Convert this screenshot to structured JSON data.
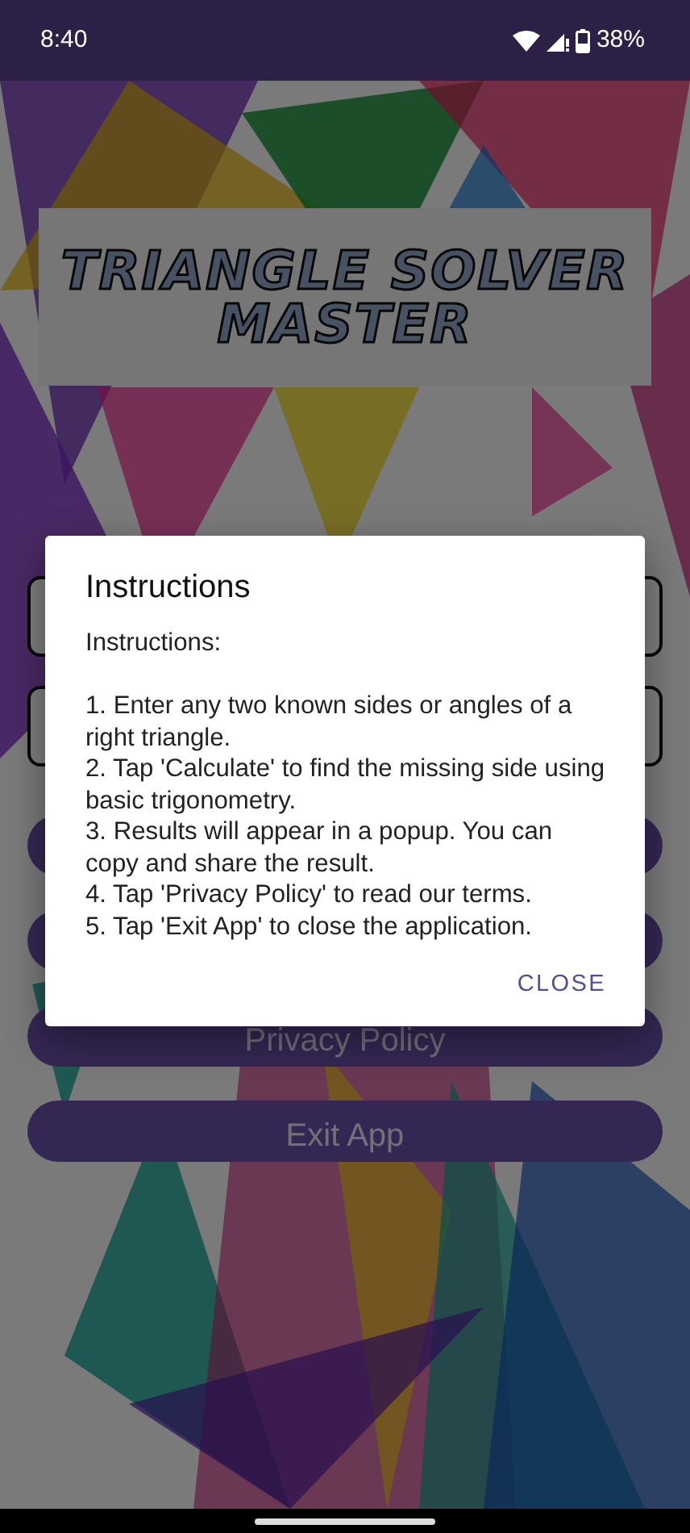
{
  "status_bar": {
    "time": "8:40",
    "battery": "38%"
  },
  "logo": {
    "lines": [
      "TRIANGLE SOLVER",
      "MASTER"
    ]
  },
  "fields": [
    {
      "kind": "outlined"
    },
    {
      "kind": "outlined"
    }
  ],
  "buttons": [
    {
      "kind": "covered"
    },
    {
      "kind": "covered"
    },
    {
      "kind": "labeled",
      "label": "Privacy Policy"
    },
    {
      "kind": "labeled",
      "label": "Exit App"
    }
  ],
  "dialog": {
    "title": "Instructions",
    "heading": "Instructions:",
    "steps": [
      "1. Enter any two known sides or angles of a right triangle.",
      "2. Tap 'Calculate' to find the missing side using basic trigonometry.",
      "3. Results will appear in a popup. You can copy and share the result.",
      "4. Tap 'Privacy Policy' to read our terms.",
      "5. Tap 'Exit App' to close the application."
    ],
    "action": "CLOSE"
  }
}
